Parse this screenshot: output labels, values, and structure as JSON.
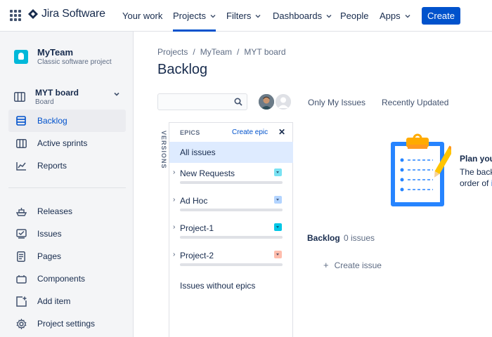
{
  "topnav": {
    "product": "Jira Software",
    "items": [
      {
        "label": "Your work"
      },
      {
        "label": "Projects"
      },
      {
        "label": "Filters"
      },
      {
        "label": "Dashboards"
      },
      {
        "label": "People"
      },
      {
        "label": "Apps"
      }
    ],
    "active_item": "Projects",
    "create_label": "Create",
    "accent_color": "#0052cc"
  },
  "sidebar": {
    "project_name": "MyTeam",
    "project_type": "Classic software project",
    "board_name": "MYT board",
    "board_type": "Board",
    "items": [
      {
        "label": "Backlog",
        "icon": "backlog-icon",
        "active": true
      },
      {
        "label": "Active sprints",
        "icon": "columns-icon"
      },
      {
        "label": "Reports",
        "icon": "chart-line-icon"
      },
      {
        "label": "Releases",
        "icon": "ship-icon"
      },
      {
        "label": "Issues",
        "icon": "issues-icon"
      },
      {
        "label": "Pages",
        "icon": "page-icon"
      },
      {
        "label": "Components",
        "icon": "component-icon"
      },
      {
        "label": "Add item",
        "icon": "add-item-icon"
      },
      {
        "label": "Project settings",
        "icon": "gear-icon"
      }
    ]
  },
  "main": {
    "breadcrumb": [
      "Projects",
      "MyTeam",
      "MYT board"
    ],
    "breadcrumb_sep": "/",
    "title": "Backlog",
    "search_placeholder": "",
    "filters": [
      "Only My Issues",
      "Recently Updated"
    ],
    "versions_tab": "VERSIONS",
    "epics": {
      "heading": "EPICS",
      "create_label": "Create epic",
      "close_glyph": "✕",
      "all_label": "All issues",
      "items": [
        {
          "name": "New Requests",
          "color": "#79e2f2"
        },
        {
          "name": "Ad Hoc",
          "color": "#b3d4ff"
        },
        {
          "name": "Project-1",
          "color": "#00c7e6"
        },
        {
          "name": "Project-2",
          "color": "#ffbdad"
        }
      ],
      "without_label": "Issues without epics"
    },
    "empty_state": {
      "title": "Plan your",
      "line1": "The back",
      "line2_prefix": "order of ",
      "line2_link": "i"
    },
    "backlog": {
      "label": "Backlog",
      "count": "0 issues",
      "create_label": "Create issue"
    }
  }
}
